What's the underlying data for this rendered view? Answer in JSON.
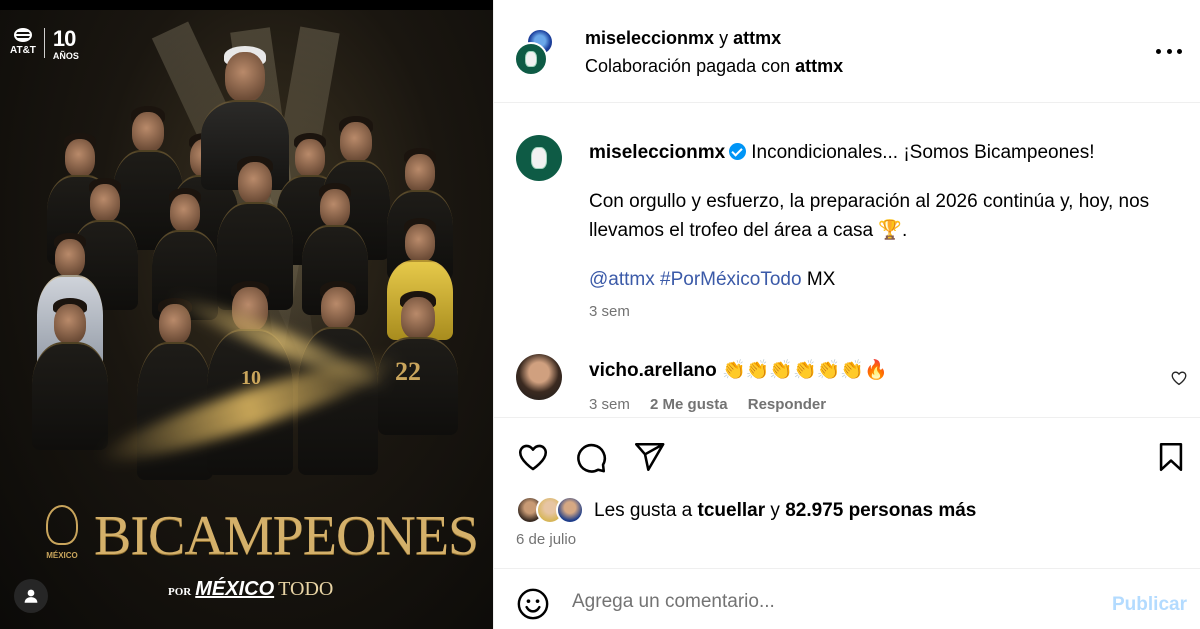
{
  "post_image": {
    "brand_anniversary": "10",
    "brand_anniversary_label": "AÑOS",
    "brand_name": "AT&T",
    "headline": "BICAMPEONES",
    "crest_label": "MÉXICO",
    "tagline_por": "POR",
    "tagline_mexico": "MÉXICO",
    "tagline_todo": "TODO",
    "jersey_numbers": [
      "10",
      "22"
    ]
  },
  "header": {
    "user1": "miseleccionmx",
    "connector": " y ",
    "user2": "attmx",
    "sub_prefix": "Colaboración pagada con ",
    "sub_partner": "attmx"
  },
  "caption": {
    "user": "miseleccionmx",
    "line1": "Incondicionales... ¡Somos Bicampeones!",
    "line2": "Con orgullo y esfuerzo, la preparación al 2026 continúa y, hoy, nos llevamos el trofeo del área a casa 🏆.",
    "mention": "@attmx",
    "hashtag": "#PorMéxicoTodo",
    "flag": " MX",
    "time": "3 sem"
  },
  "comment": {
    "user": "vicho.arellano",
    "text": "👏👏👏👏👏👏🔥",
    "time": "3 sem",
    "likes": "2 Me gusta",
    "reply": "Responder"
  },
  "likes": {
    "prefix": "Les gusta a ",
    "user": "tcuellar",
    "middle": " y ",
    "count": "82.975 personas más"
  },
  "post_date": "6 de julio",
  "comment_box": {
    "placeholder": "Agrega un comentario...",
    "submit": "Publicar"
  },
  "colors": {
    "verified": "#0095f6",
    "link": "#3b5aa8",
    "muted": "#737373",
    "post_disabled": "#b3dbff",
    "gold": "#d4b06a"
  }
}
